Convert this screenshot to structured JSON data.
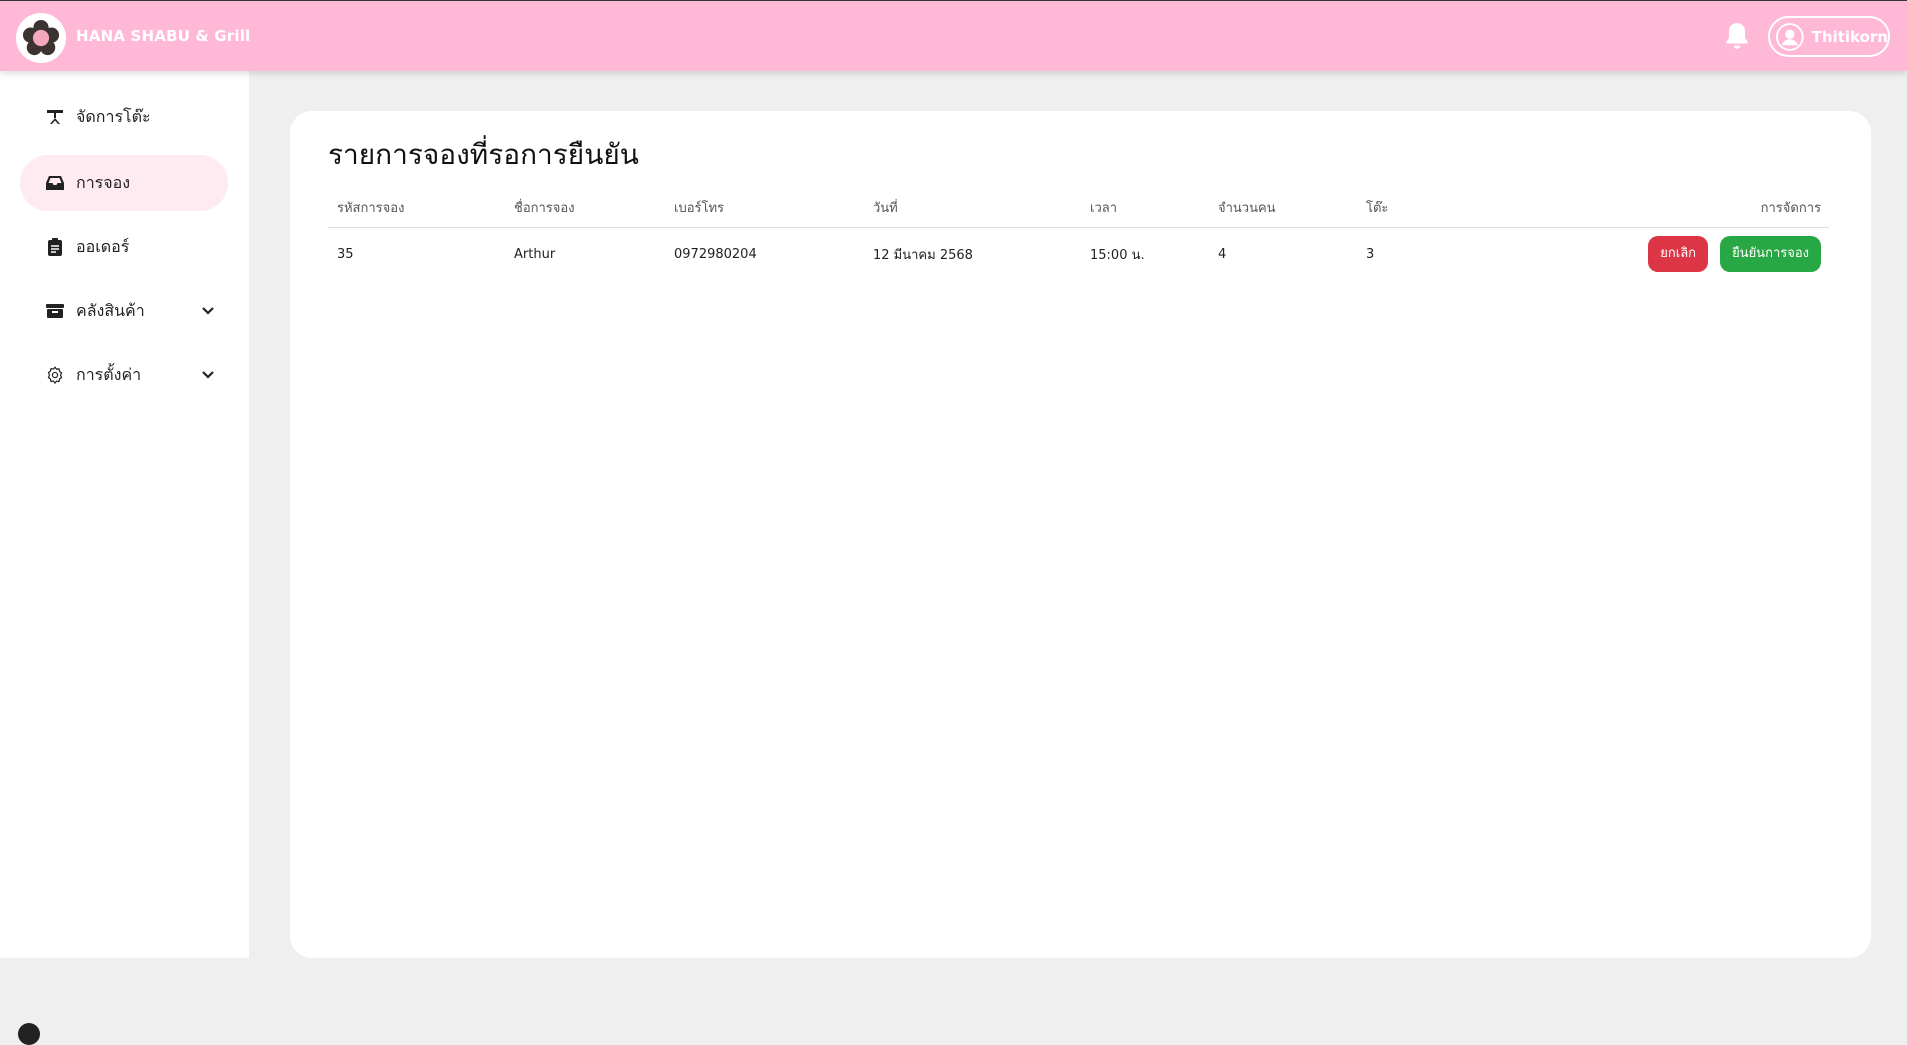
{
  "header": {
    "brand": "HANA SHABU & Grill",
    "user_name": "Thitikorn",
    "colors": {
      "header_bg": "#ffb8d6",
      "active_nav": "#fdebf1"
    }
  },
  "sidebar": {
    "items": [
      {
        "label": "จัดการโต๊ะ",
        "icon": "table-icon",
        "active": false
      },
      {
        "label": "การจอง",
        "icon": "inbox-icon",
        "active": true
      },
      {
        "label": "ออเดอร์",
        "icon": "clipboard-icon",
        "active": false
      },
      {
        "label": "คลังสินค้า",
        "icon": "archive-icon",
        "active": false,
        "expandable": true
      },
      {
        "label": "การตั้งค่า",
        "icon": "gear-icon",
        "active": false,
        "expandable": true
      }
    ]
  },
  "main": {
    "title": "รายการจองที่รอการยืนยัน",
    "columns": [
      "รหัสการจอง",
      "ชื่อการจอง",
      "เบอร์โทร",
      "วันที่",
      "เวลา",
      "จำนวนคน",
      "โต๊ะ",
      "การจัดการ"
    ],
    "rows": [
      {
        "id": "35",
        "name": "Arthur",
        "phone": "0972980204",
        "date": "12 มีนาคม 2568",
        "time": "15:00 น.",
        "guests": "4",
        "table": "3",
        "cancel_label": "ยกเลิก",
        "confirm_label": "ยืนยันการจอง"
      }
    ]
  }
}
